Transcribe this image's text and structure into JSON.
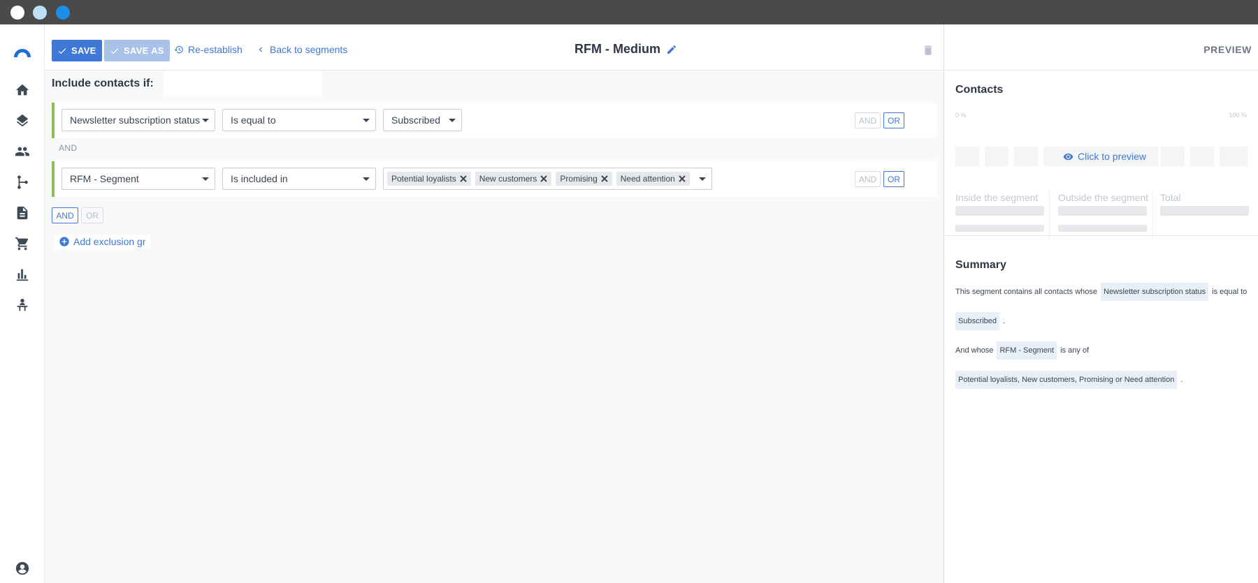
{
  "window": {
    "dots": [
      "#ffffff",
      "#bde0f7",
      "#1b8ee8"
    ]
  },
  "toolbar": {
    "save_label": "SAVE",
    "save_as_label": "SAVE AS",
    "reestablish_label": "Re-establish",
    "back_label": "Back to segments"
  },
  "segment": {
    "title": "RFM - Medium"
  },
  "builder": {
    "include_heading": "Include contacts if:",
    "conditions": [
      {
        "field": "Newsletter subscription status",
        "operator": "Is equal to",
        "value": "Subscribed"
      },
      {
        "field": "RFM - Segment",
        "operator": "Is included in",
        "values": [
          "Potential loyalists",
          "New customers",
          "Promising",
          "Need attention"
        ]
      }
    ],
    "and_sep": "AND",
    "and_label": "AND",
    "or_label": "OR",
    "add_exclusion_label": "Add exclusion gr"
  },
  "preview": {
    "tab_label": "PREVIEW",
    "contacts_heading": "Contacts",
    "scale_min": "0 %",
    "scale_max": "100 %",
    "click_to_preview": "Click to preview",
    "inside_label": "Inside the segment",
    "outside_label": "Outside the segment",
    "total_label": "Total",
    "summary_heading": "Summary",
    "summary": {
      "s1_pre": "This segment contains all contacts whose",
      "s1_tag": "Newsletter subscription status",
      "s1_mid": "is equal to",
      "s1_val": "Subscribed",
      "period": ".",
      "s2_pre": "And whose",
      "s2_tag": "RFM - Segment",
      "s2_mid": "is any of",
      "s2_val": "Potential loyalists, New customers, Promising or Need attention"
    }
  },
  "colors": {
    "accent": "#3f78d6",
    "condition_bar": "#8cc152"
  }
}
